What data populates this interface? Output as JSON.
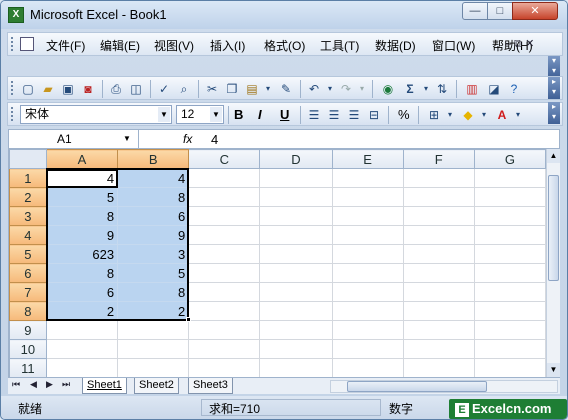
{
  "window": {
    "title": "Microsoft Excel - Book1",
    "app_icon": "X"
  },
  "caption_buttons": {
    "minimize": "—",
    "maximize": "□",
    "close": "✕"
  },
  "menu": [
    "文件(F)",
    "编辑(E)",
    "视图(V)",
    "插入(I)",
    "格式(O)",
    "工具(T)",
    "数据(D)",
    "窗口(W)",
    "帮助(H)"
  ],
  "doc_controls": "–  ⧉  ✕",
  "standard_toolbar_icons": [
    "new-icon",
    "open-icon",
    "save-icon",
    "permission-icon",
    "print-icon",
    "print-preview-icon",
    "spelling-icon",
    "research-icon",
    "cut-icon",
    "copy-icon",
    "paste-icon",
    "format-painter-icon",
    "undo-icon",
    "redo-icon",
    "hyperlink-icon",
    "autosum-icon",
    "sort-icon",
    "chart-wizard-icon",
    "help-icon"
  ],
  "formatting": {
    "font": "宋体",
    "size": "12",
    "bold": "B",
    "italic": "I",
    "underline": "U",
    "percent": "%",
    "autosum": "Σ"
  },
  "formula_bar": {
    "cell_ref": "A1",
    "fx": "fx",
    "value": "4"
  },
  "columns": [
    "A",
    "B",
    "C",
    "D",
    "E",
    "F",
    "G"
  ],
  "rows": [
    {
      "n": "1",
      "a": "4",
      "b": "4"
    },
    {
      "n": "2",
      "a": "5",
      "b": "8"
    },
    {
      "n": "3",
      "a": "8",
      "b": "6"
    },
    {
      "n": "4",
      "a": "9",
      "b": "9"
    },
    {
      "n": "5",
      "a": "623",
      "b": "3"
    },
    {
      "n": "6",
      "a": "8",
      "b": "5"
    },
    {
      "n": "7",
      "a": "6",
      "b": "8"
    },
    {
      "n": "8",
      "a": "2",
      "b": "2"
    },
    {
      "n": "9",
      "a": "",
      "b": ""
    },
    {
      "n": "10",
      "a": "",
      "b": ""
    },
    {
      "n": "11",
      "a": "",
      "b": ""
    }
  ],
  "sheets": [
    "Sheet1",
    "Sheet2",
    "Sheet3"
  ],
  "status": {
    "ready": "就绪",
    "sum": "求和=710",
    "mode": "数字"
  },
  "watermark": {
    "logo": "E",
    "text": "Excelcn.com"
  }
}
